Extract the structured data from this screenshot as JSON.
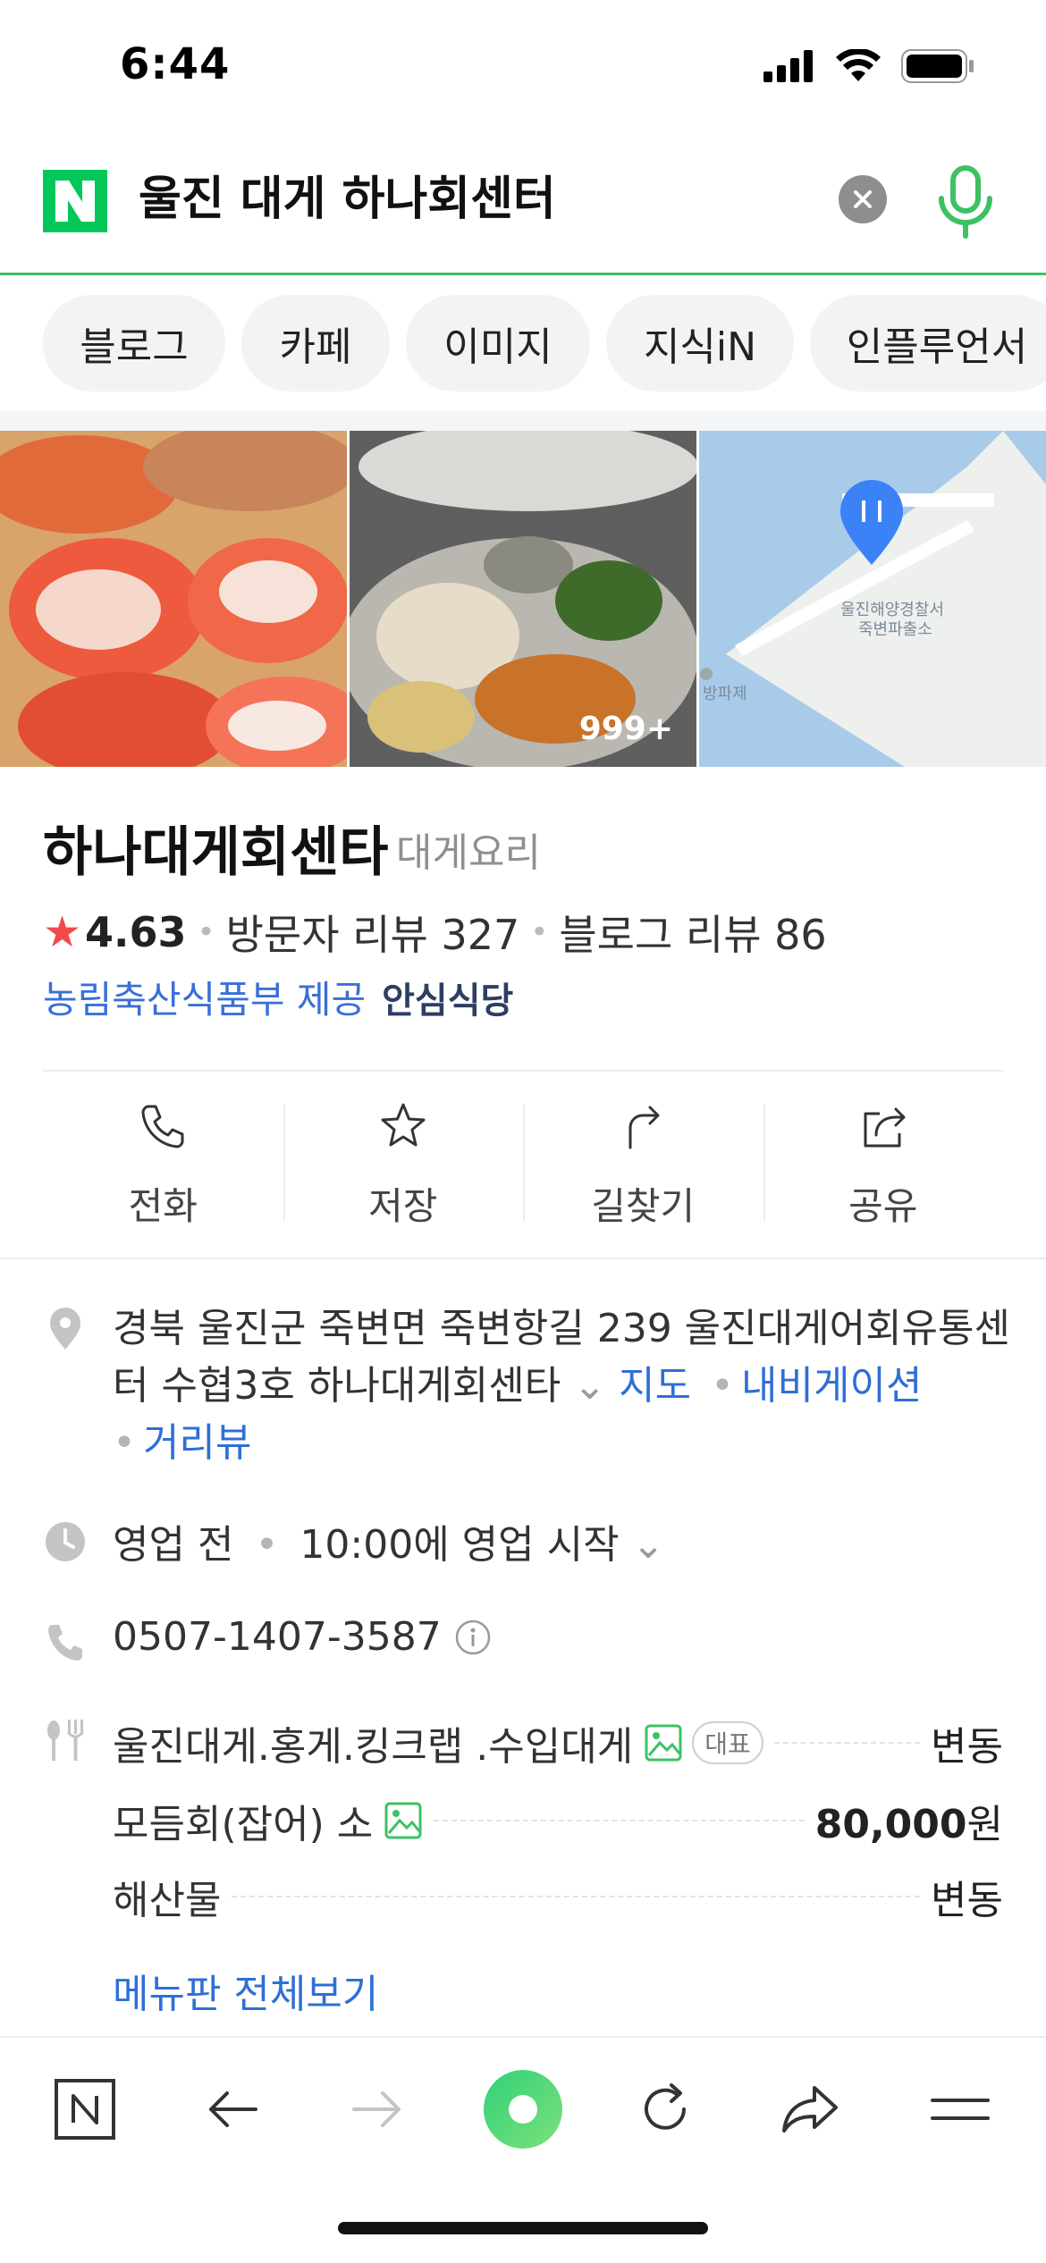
{
  "status_bar": {
    "time": "6:44"
  },
  "search": {
    "query": "울진 대게 하나회센터"
  },
  "tabs": [
    {
      "label": "블로그"
    },
    {
      "label": "카페"
    },
    {
      "label": "이미지"
    },
    {
      "label": "지식iN"
    },
    {
      "label": "인플루언서"
    }
  ],
  "photos": {
    "count_label": "999+",
    "map_labels": [
      "울진해양경찰서",
      "죽변파출소",
      "방파제"
    ]
  },
  "place": {
    "name": "하나대게회센타",
    "category": "대게요리",
    "rating": "4.63",
    "visitor_reviews": "방문자 리뷰 327",
    "blog_reviews": "블로그 리뷰 86",
    "cert_provider": "농림축산식품부 제공",
    "cert_badge": "안심식당"
  },
  "actions": [
    {
      "label": "전화",
      "icon": "phone-icon"
    },
    {
      "label": "저장",
      "icon": "star-icon"
    },
    {
      "label": "길찾기",
      "icon": "directions-icon"
    },
    {
      "label": "공유",
      "icon": "share-icon"
    }
  ],
  "details": {
    "address": "경북 울진군 죽변면 죽변항길 239 울진대게어회유통센터 수협3호 하나대게회센타",
    "map_link": "지도",
    "navigation_link": "내비게이션",
    "street_view_link": "거리뷰",
    "hours_status": "영업 전",
    "hours_detail": "10:00에 영업 시작",
    "phone": "0507-1407-3587"
  },
  "menu": {
    "items": [
      {
        "name": "울진대게.홍게.킹크랩 .수입대게",
        "badge": "대표",
        "price": "변동"
      },
      {
        "name": "모듬회(잡어) 소",
        "price_value": "80,000",
        "price_unit": "원"
      },
      {
        "name": "해산물",
        "price": "변동"
      }
    ],
    "view_all": "메뉴판 전체보기"
  },
  "colors": {
    "brand_green": "#03c75a",
    "link_blue": "#2f6fd6",
    "star_red": "#f24a4a"
  }
}
